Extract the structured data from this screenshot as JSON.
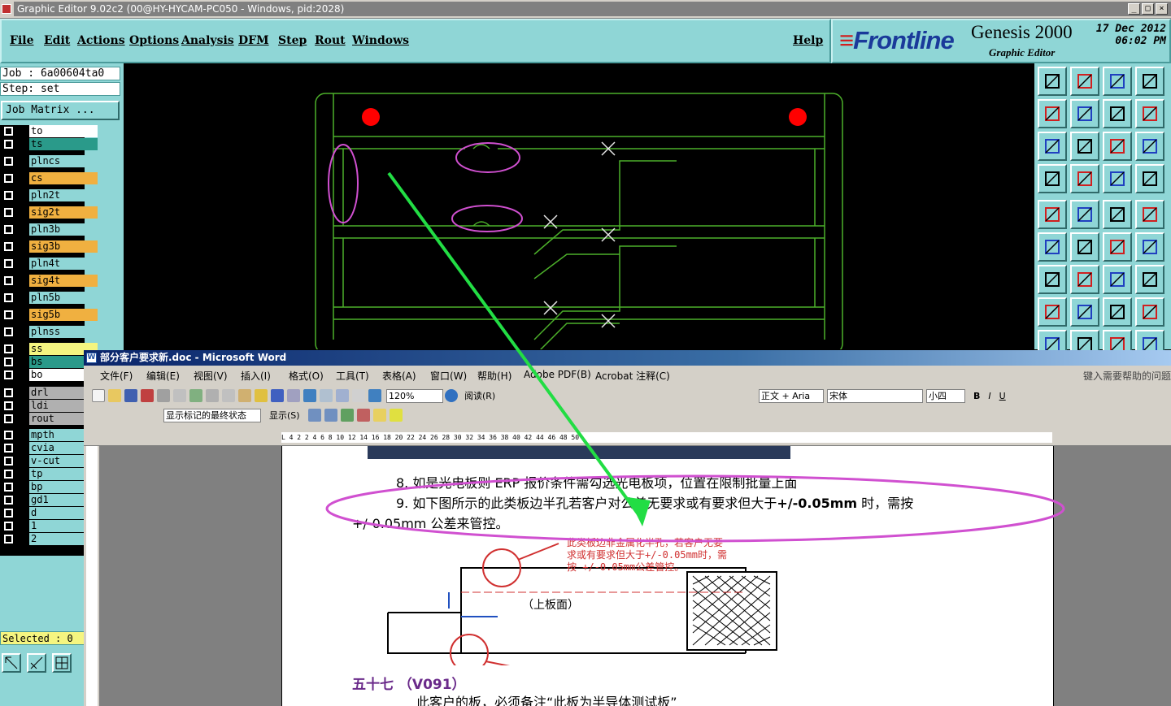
{
  "genesis": {
    "title": "Graphic Editor 9.02c2 (00@HY-HYCAM-PC050 - Windows, pid:2028)",
    "menu": [
      "File",
      "Edit",
      "Actions",
      "Options",
      "Analysis",
      "DFM",
      "Step",
      "Rout",
      "Windows"
    ],
    "help": "Help",
    "logo": "Frontline",
    "product": "Genesis 2000",
    "subtitle": "Graphic Editor",
    "date": "17 Dec 2012",
    "time": "06:02 PM",
    "job": "Job : 6a00604ta0",
    "step": "Step: set",
    "job_matrix": "Job Matrix ...",
    "layers": [
      {
        "name": "to",
        "color": "#ffffff"
      },
      {
        "name": "ts",
        "color": "#2a9a8a"
      },
      {
        "name": "plncs",
        "color": "#8fd6d6"
      },
      {
        "name": "cs",
        "color": "#f0b040"
      },
      {
        "name": "pln2t",
        "color": "#8fd6d6"
      },
      {
        "name": "sig2t",
        "color": "#f0b040"
      },
      {
        "name": "pln3b",
        "color": "#8fd6d6"
      },
      {
        "name": "sig3b",
        "color": "#f0b040"
      },
      {
        "name": "pln4t",
        "color": "#8fd6d6"
      },
      {
        "name": "sig4t",
        "color": "#f0b040"
      },
      {
        "name": "pln5b",
        "color": "#8fd6d6"
      },
      {
        "name": "sig5b",
        "color": "#f0b040"
      },
      {
        "name": "plnss",
        "color": "#8fd6d6"
      },
      {
        "name": "ss",
        "color": "#f5f580"
      },
      {
        "name": "bs",
        "color": "#2a9a8a"
      },
      {
        "name": "bo",
        "color": "#ffffff"
      },
      {
        "name": "drl",
        "color": "#b0b0b0"
      },
      {
        "name": "ldi",
        "color": "#b0b0b0"
      },
      {
        "name": "rout",
        "color": "#b0b0b0"
      },
      {
        "name": "mpth",
        "color": "#8fd6d6"
      },
      {
        "name": "cvia",
        "color": "#8fd6d6"
      },
      {
        "name": "v-cut",
        "color": "#8fd6d6"
      },
      {
        "name": "tp",
        "color": "#8fd6d6"
      },
      {
        "name": "bp",
        "color": "#8fd6d6"
      },
      {
        "name": "gd1",
        "color": "#8fd6d6"
      },
      {
        "name": "d",
        "color": "#8fd6d6"
      },
      {
        "name": "1",
        "color": "#8fd6d6"
      },
      {
        "name": "2",
        "color": "#8fd6d6"
      }
    ],
    "selected": "Selected : 0",
    "toolbox_icons": [
      "layer-up-icon",
      "layer-down-icon",
      "zoom-home-icon",
      "zoom-window-icon",
      "pan-left-icon",
      "pan-right-icon",
      "zoom-fit-icon",
      "measure-icon",
      "zoom-extent-icon",
      "zoom-center-icon",
      "zoom-1to1-icon",
      "help-icon",
      "filter-icon",
      "key-icon",
      "snap-icon",
      "snap2-icon",
      "add-pad-icon",
      "add-shape-icon",
      "ruler-icon",
      "pad-icon",
      "connect-icon",
      "cross-icon",
      "line-point-icon",
      "move-point-icon",
      "angle-icon",
      "slope-icon",
      "arc-icon",
      "split-icon",
      "copy-icon",
      "line-icon",
      "box-icon",
      "grid-icon",
      "tri-icon",
      "tri2-icon",
      "tri3-icon",
      "tri4-icon"
    ]
  },
  "word": {
    "title": "部分客户要求新.doc - Microsoft Word",
    "menu": [
      "文件(F)",
      "编辑(E)",
      "视图(V)",
      "插入(I)",
      "格式(O)",
      "工具(T)",
      "表格(A)",
      "窗口(W)",
      "帮助(H)",
      "Adobe PDF(B)",
      "Acrobat 注释(C)"
    ],
    "help_box": "键入需要帮助的问题",
    "zoom": "120%",
    "read_label": "阅读(R)",
    "style": "正文 + Aria",
    "font": "宋体",
    "size": "小四",
    "markup_view": "显示标记的最终状态",
    "show_menu": "显示(S)",
    "ruler_marks": "L  4  2     2  4  6  8  10  12  14  16  18  20  22  24  26  28  30  32  34  36  38  40  42  44  46  48  50",
    "item8": "8. 如是光电板则 ERP 报价条件需勾选光电板项，位置在限制批量上面",
    "item9a": "9.  如下图所示的此类板边半孔若客户对公差无要求或有要求但大于",
    "item9b": "+/-0.05mm",
    "item9c": " 时，需按",
    "item9d": "+/-0.05mm",
    "item9e": " 公差来管控。",
    "diagram_note1": "此类板边非金属化半孔，若客户无要",
    "diagram_note2": "求或有要求但大于+/-0.05mm时，需",
    "diagram_note3": "按 +/-0.05mm公差管控。",
    "diagram_label": "（上板面）",
    "section": "五十七  （V091）",
    "next_line": "此客户的板，必须备注“此板为半导体测试板”"
  }
}
